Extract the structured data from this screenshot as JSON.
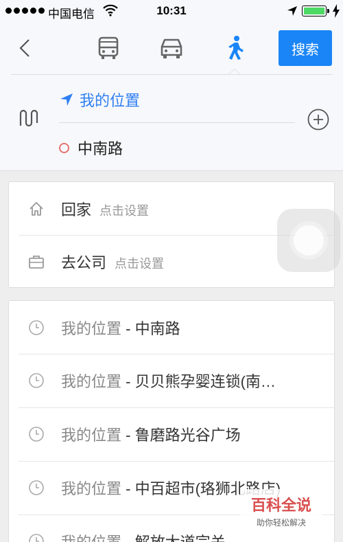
{
  "status_bar": {
    "carrier": "中国电信",
    "time": "10:31",
    "battery_level": 1.0,
    "icons": [
      "signal-dots-icon",
      "wifi-icon",
      "location-arrow-icon",
      "battery-icon",
      "charging-bolt-icon"
    ]
  },
  "header": {
    "modes": [
      {
        "name": "bus",
        "icon": "bus-icon",
        "selected": false
      },
      {
        "name": "car",
        "icon": "car-icon",
        "selected": false
      },
      {
        "name": "walk",
        "icon": "walk-icon",
        "selected": true
      }
    ],
    "search_label": "搜索",
    "accent_color": "#1a85f6",
    "from_text": "我的位置",
    "to_text": "中南路"
  },
  "places": [
    {
      "label": "回家",
      "hint": "点击设置",
      "icon": "home-icon"
    },
    {
      "label": "去公司",
      "hint": "点击设置",
      "icon": "briefcase-icon"
    }
  ],
  "history": [
    {
      "from": "我的位置",
      "sep": " - ",
      "to": "中南路"
    },
    {
      "from": "我的位置",
      "sep": " - ",
      "to": "贝贝熊孕婴连锁(南…"
    },
    {
      "from": "我的位置",
      "sep": " - ",
      "to": "鲁磨路光谷广场"
    },
    {
      "from": "我的位置",
      "sep": " - ",
      "to": "中百超市(珞狮北路店)"
    },
    {
      "from": "我的位置",
      "sep": " - ",
      "to": "解放大道宗关"
    }
  ],
  "watermark": {
    "title": "百科全说",
    "subtitle": "助你轻松解决"
  }
}
